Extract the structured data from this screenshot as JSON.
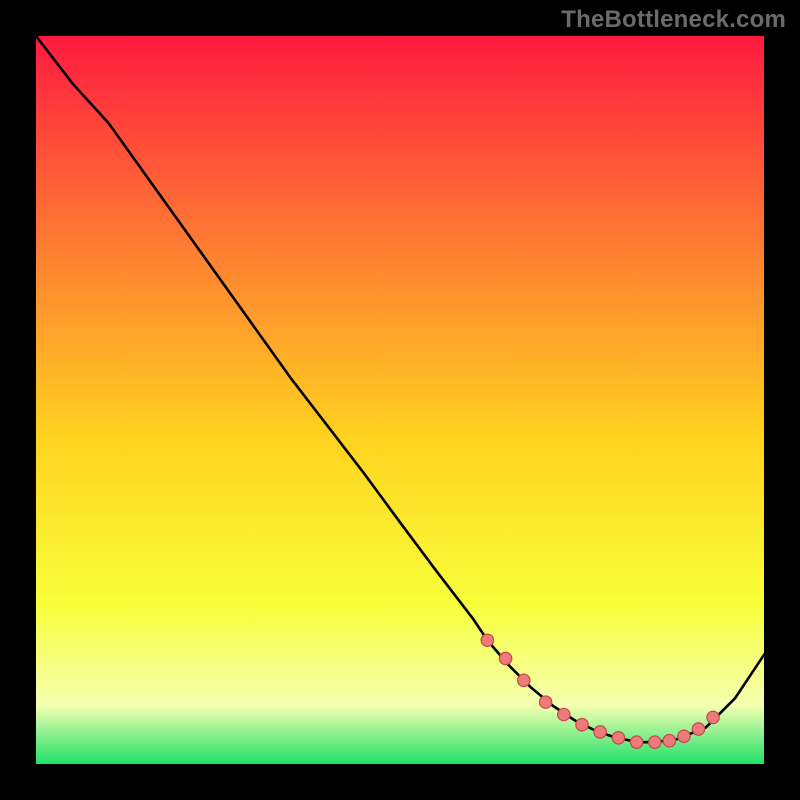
{
  "watermark": "TheBottleneck.com",
  "colors": {
    "bg": "#000000",
    "curve": "#000000",
    "marker_fill": "#ee7b7b",
    "marker_stroke": "#c54848",
    "grad_top": "#ff1a3f",
    "grad_upper_mid": "#ff7a33",
    "grad_mid": "#ffd21f",
    "grad_lower_mid": "#f8ff3a",
    "grad_pale": "#f3ffb0",
    "grad_green": "#1fe06a"
  },
  "chart_data": {
    "type": "line",
    "title": "",
    "xlabel": "",
    "ylabel": "",
    "xlim": [
      0,
      100
    ],
    "ylim": [
      0,
      100
    ],
    "series": [
      {
        "name": "curve",
        "x": [
          0,
          5,
          10,
          15,
          20,
          25,
          30,
          35,
          40,
          45,
          50,
          55,
          60,
          62,
          65,
          68,
          71,
          74,
          77,
          80,
          83,
          85,
          88,
          92,
          96,
          100
        ],
        "y": [
          100,
          93.5,
          88,
          81,
          74,
          67,
          60,
          53,
          46.5,
          40,
          33.2,
          26.5,
          20,
          17,
          13.5,
          10.5,
          8,
          6,
          4.5,
          3.5,
          3,
          3,
          3.4,
          5,
          9,
          15
        ]
      }
    ],
    "markers": {
      "name": "highlight-points",
      "x": [
        62,
        64.5,
        67,
        70,
        72.5,
        75,
        77.5,
        80,
        82.5,
        85,
        87,
        89,
        91,
        93
      ],
      "y": [
        17,
        14.5,
        11.5,
        8.5,
        6.8,
        5.4,
        4.4,
        3.6,
        3.0,
        3.0,
        3.2,
        3.8,
        4.8,
        6.4
      ]
    }
  }
}
